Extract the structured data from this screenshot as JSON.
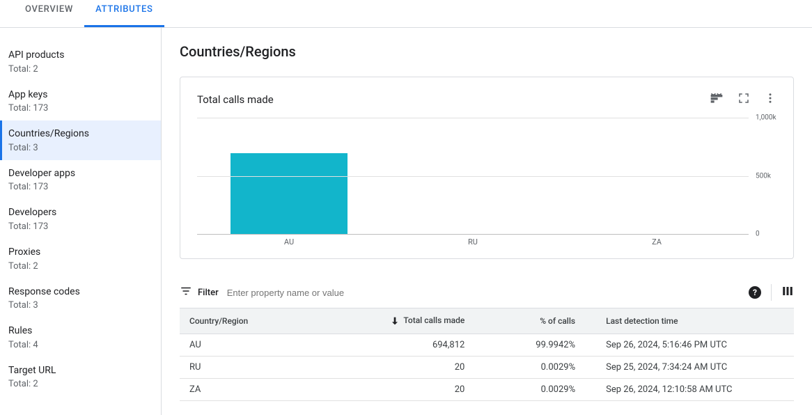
{
  "tabs": {
    "overview": "OVERVIEW",
    "attributes": "ATTRIBUTES"
  },
  "sidebar": {
    "total_prefix": "Total: ",
    "items": [
      {
        "label": "API products",
        "total": "2"
      },
      {
        "label": "App keys",
        "total": "173"
      },
      {
        "label": "Countries/Regions",
        "total": "3"
      },
      {
        "label": "Developer apps",
        "total": "173"
      },
      {
        "label": "Developers",
        "total": "173"
      },
      {
        "label": "Proxies",
        "total": "2"
      },
      {
        "label": "Response codes",
        "total": "3"
      },
      {
        "label": "Rules",
        "total": "4"
      },
      {
        "label": "Target URL",
        "total": "2"
      }
    ]
  },
  "page_title": "Countries/Regions",
  "chart": {
    "title": "Total calls made",
    "yticks": [
      "1,000k",
      "500k",
      "0"
    ]
  },
  "chart_data": {
    "type": "bar",
    "title": "Total calls made",
    "categories": [
      "AU",
      "RU",
      "ZA"
    ],
    "values": [
      694812,
      20,
      20
    ],
    "ylabel": "",
    "xlabel": "",
    "ylim": [
      0,
      1000000
    ]
  },
  "filter": {
    "label": "Filter",
    "placeholder": "Enter property name or value",
    "help": "?"
  },
  "table": {
    "columns": {
      "country": "Country/Region",
      "calls": "Total calls made",
      "percent": "% of calls",
      "time": "Last detection time"
    },
    "rows": [
      {
        "country": "AU",
        "calls": "694,812",
        "percent": "99.9942%",
        "time": "Sep 26, 2024, 5:16:46 PM UTC"
      },
      {
        "country": "RU",
        "calls": "20",
        "percent": "0.0029%",
        "time": "Sep 25, 2024, 7:34:24 AM UTC"
      },
      {
        "country": "ZA",
        "calls": "20",
        "percent": "0.0029%",
        "time": "Sep 26, 2024, 12:10:58 AM UTC"
      }
    ]
  }
}
